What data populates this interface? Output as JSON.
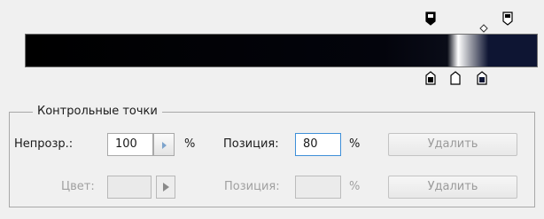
{
  "gradient_editor": {
    "opacity_stop_icon": "opacity-stop-marker-icon",
    "midpoint_icon": "midpoint-diamond-icon",
    "color_stop_icon": "color-stop-marker-icon",
    "colors": {
      "left": "#000000",
      "highlight": "#ffffff",
      "right": "#0e1533"
    }
  },
  "control_points": {
    "legend": "Контрольные точки",
    "opacity": {
      "label": "Непрозр.:",
      "value": "100",
      "unit": "%",
      "position_label": "Позиция:",
      "position_value": "80",
      "position_unit": "%",
      "delete_label": "Удалить"
    },
    "color": {
      "label": "Цвет:",
      "position_label": "Позиция:",
      "position_value": "",
      "position_unit": "%",
      "delete_label": "Удалить"
    }
  }
}
